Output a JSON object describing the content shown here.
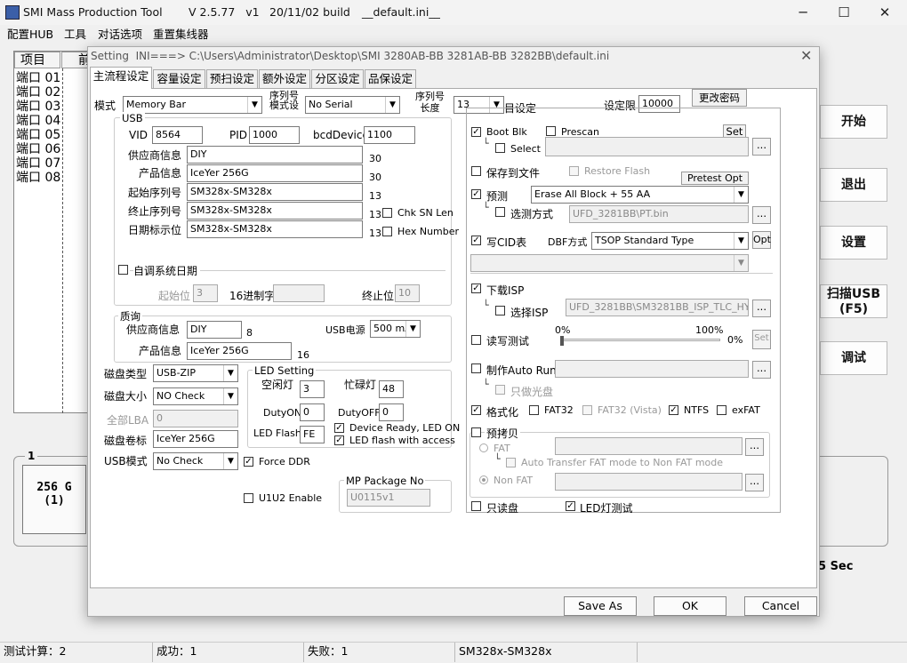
{
  "window": {
    "app_name": "SMI Mass Production Tool",
    "version": "V 2.5.77   v1",
    "build": "20/11/02 build",
    "ini": "__default.ini__"
  },
  "menu": [
    "配置HUB",
    "工具",
    "对话选项",
    "重置集线器"
  ],
  "port_list": {
    "header": [
      "项目",
      "前"
    ],
    "rows": [
      "端口 01",
      "端口 02",
      "端口 03",
      "端口 04",
      "端口 05",
      "端口 06",
      "端口 07",
      "端口 08"
    ]
  },
  "right_buttons": [
    "开始",
    "退出",
    "设置",
    "扫描USB\n(F5)",
    "调试"
  ],
  "card": {
    "group_num": "1",
    "line1": "256 G",
    "line2": "(1)",
    "time": "5 Sec"
  },
  "status": {
    "count": "测试计算：2",
    "success": "成功：1",
    "fail": "失败：1",
    "model": "SM328x-SM328x"
  },
  "dialog": {
    "title": "Setting  INI===> C:\\Users\\Administrator\\Desktop\\SMI 3280AB-BB 3281AB-BB 3282BB\\default.ini",
    "close": "✕",
    "tabs": [
      "主流程设定",
      "容量设定",
      "预扫设定",
      "额外设定",
      "分区设定",
      "品保设定"
    ],
    "mode_label": "模式",
    "mode_value": "Memory Bar",
    "serial_mode_label": "序列号\n模式设",
    "serial_mode_value": "No Serial",
    "serial_len_label": "序列号\n长度",
    "serial_len_value": "13",
    "self_set": "目设定",
    "limit_label": "设定限",
    "limit_value": "10000",
    "change_pwd": "更改密码",
    "usb": {
      "title": "USB",
      "vid_label": "VID",
      "vid": "8564",
      "pid_label": "PID",
      "pid": "1000",
      "bcd_label": "bcdDevice",
      "bcd": "1100",
      "vendor_label": "供应商信息",
      "vendor": "DIY",
      "vendor_len": "30",
      "product_label": "产品信息",
      "product": "IceYer 256G",
      "product_len": "30",
      "start_sn_label": "起始序列号",
      "start_sn": "SM328x-SM328x",
      "start_sn_len": "13",
      "end_sn_label": "终止序列号",
      "end_sn": "SM328x-SM328x",
      "end_sn_len": "13",
      "date_label": "日期标示位",
      "date": "SM328x-SM328x",
      "date_len": "13",
      "chk_sn_len": "Chk SN Len",
      "hex_number": "Hex Number",
      "auto_date": "自调系统日期",
      "start_pos": "起始位",
      "start_pos_val": "3",
      "hex_str": "16进制字",
      "end_pos": "终止位",
      "end_pos_val": "10"
    },
    "quality": {
      "title": "质询",
      "vendor_label": "供应商信息",
      "vendor": "DIY",
      "vendor_len": "8",
      "power_label": "USB电源",
      "power": "500 mA",
      "product_label": "产品信息",
      "product": "IceYer 256G",
      "product_len": "16"
    },
    "disk_type_label": "磁盘类型",
    "disk_type": "USB-ZIP",
    "disk_size_label": "磁盘大小",
    "disk_size": "NO Check",
    "lba_label": "全部LBA",
    "lba": "0",
    "volume_label": "磁盘卷标",
    "volume": "IceYer 256G",
    "usb_mode_label": "USB模式",
    "usb_mode": "No Check",
    "force_ddr": "Force DDR",
    "u1u2": "U1U2 Enable",
    "led": {
      "title": "LED Setting",
      "idle_label": "空闲灯",
      "idle": "3",
      "busy_label": "忙碌灯",
      "busy": "48",
      "dutyon_label": "DutyON",
      "dutyon": "0",
      "dutyoff_label": "DutyOFF",
      "dutyoff": "0",
      "flash_label": "LED Flash",
      "flash": "FE",
      "ready": "Device Ready, LED ON",
      "access": "LED flash with access"
    },
    "mp": {
      "title": "MP Package No",
      "value": "U0115v1"
    },
    "right": {
      "boot_blk": "Boot Blk",
      "prescan": "Prescan",
      "set": "Set",
      "select": "Select",
      "dots": "...",
      "save_file": "保存到文件",
      "restore_flash": "Restore Flash",
      "pretest_opt": "Pretest Opt",
      "pretest": "预测",
      "pretest_value": "Erase All Block + 55 AA",
      "pretest_method": "选测方式",
      "pretest_file": "UFD_3281BB\\PT.bin",
      "write_cid": "写CID表",
      "dbf_label": "DBF方式",
      "dbf_value": "TSOP Standard Type",
      "opt": "Opt",
      "download_isp": "下载ISP",
      "select_isp": "选择ISP",
      "isp_file": "UFD_3281BB\\SM3281BB_ISP_TLC_HY.BIN",
      "rw_test": "读写测试",
      "pct0": "0%",
      "pct100": "100%",
      "pct_val": "0%",
      "rw_set": "Set",
      "auto_run": "制作Auto Run",
      "cdrom_only": "只做光盘",
      "format": "格式化",
      "fat32": "FAT32",
      "fat32_vista": "FAT32 (Vista)",
      "ntfs": "NTFS",
      "exfat": "exFAT",
      "precopy": "预拷贝",
      "fat": "FAT",
      "auto_transfer": "Auto Transfer FAT mode to Non FAT mode",
      "non_fat": "Non FAT",
      "readonly": "只读盘",
      "led_test": "LED灯测试"
    },
    "buttons": {
      "save_as": "Save  As",
      "ok": "OK",
      "cancel": "Cancel"
    }
  }
}
